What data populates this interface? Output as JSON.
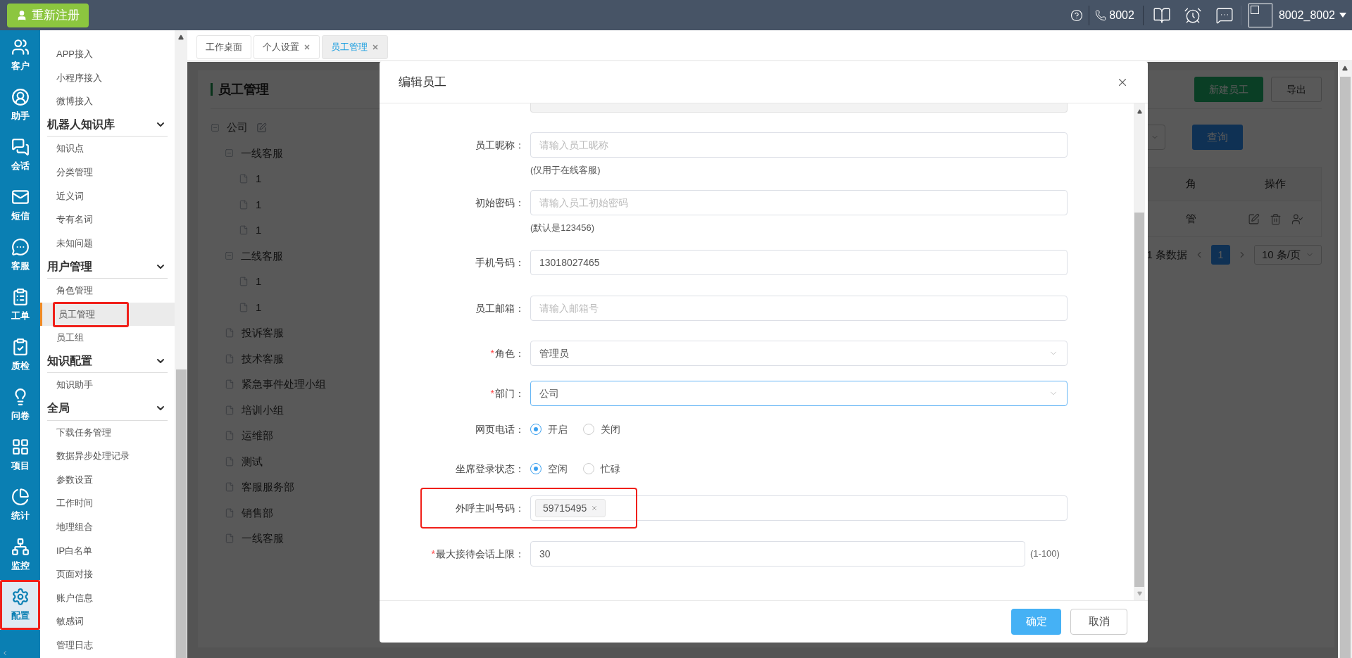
{
  "topbar": {
    "register_button": "重新注册",
    "extension": "8002",
    "user": "8002_8002"
  },
  "rail": [
    {
      "label": "客户",
      "selected": false,
      "highlighted": false
    },
    {
      "label": "助手",
      "selected": false,
      "highlighted": false
    },
    {
      "label": "会话",
      "selected": false,
      "highlighted": false
    },
    {
      "label": "短信",
      "selected": false,
      "highlighted": false
    },
    {
      "label": "客服",
      "selected": false,
      "highlighted": false
    },
    {
      "label": "工单",
      "selected": false,
      "highlighted": false
    },
    {
      "label": "质检",
      "selected": false,
      "highlighted": false
    },
    {
      "label": "问卷",
      "selected": false,
      "highlighted": false
    },
    {
      "label": "项目",
      "selected": false,
      "highlighted": false
    },
    {
      "label": "统计",
      "selected": false,
      "highlighted": false
    },
    {
      "label": "监控",
      "selected": false,
      "highlighted": false
    },
    {
      "label": "配置",
      "selected": true,
      "highlighted": true
    }
  ],
  "submenu": [
    {
      "kind": "item",
      "label": "APP接入",
      "selected": false,
      "highlighted": false
    },
    {
      "kind": "item",
      "label": "小程序接入",
      "selected": false,
      "highlighted": false
    },
    {
      "kind": "item",
      "label": "微博接入",
      "selected": false,
      "highlighted": false
    },
    {
      "kind": "header",
      "label": "机器人知识库",
      "expanded": true
    },
    {
      "kind": "item",
      "label": "知识点",
      "selected": false,
      "highlighted": false
    },
    {
      "kind": "item",
      "label": "分类管理",
      "selected": false,
      "highlighted": false
    },
    {
      "kind": "item",
      "label": "近义词",
      "selected": false,
      "highlighted": false
    },
    {
      "kind": "item",
      "label": "专有名词",
      "selected": false,
      "highlighted": false
    },
    {
      "kind": "item",
      "label": "未知问题",
      "selected": false,
      "highlighted": false
    },
    {
      "kind": "header",
      "label": "用户管理",
      "expanded": true
    },
    {
      "kind": "item",
      "label": "角色管理",
      "selected": false,
      "highlighted": false
    },
    {
      "kind": "item",
      "label": "员工管理",
      "selected": true,
      "highlighted": true
    },
    {
      "kind": "item",
      "label": "员工组",
      "selected": false,
      "highlighted": false
    },
    {
      "kind": "header",
      "label": "知识配置",
      "expanded": true
    },
    {
      "kind": "item",
      "label": "知识助手",
      "selected": false,
      "highlighted": false
    },
    {
      "kind": "header",
      "label": "全局",
      "expanded": true
    },
    {
      "kind": "item",
      "label": "下载任务管理",
      "selected": false,
      "highlighted": false
    },
    {
      "kind": "item",
      "label": "数据异步处理记录",
      "selected": false,
      "highlighted": false
    },
    {
      "kind": "item",
      "label": "参数设置",
      "selected": false,
      "highlighted": false
    },
    {
      "kind": "item",
      "label": "工作时间",
      "selected": false,
      "highlighted": false
    },
    {
      "kind": "item",
      "label": "地理组合",
      "selected": false,
      "highlighted": false
    },
    {
      "kind": "item",
      "label": "IP白名单",
      "selected": false,
      "highlighted": false
    },
    {
      "kind": "item",
      "label": "页面对接",
      "selected": false,
      "highlighted": false
    },
    {
      "kind": "item",
      "label": "账户信息",
      "selected": false,
      "highlighted": false
    },
    {
      "kind": "item",
      "label": "敏感词",
      "selected": false,
      "highlighted": false
    },
    {
      "kind": "item",
      "label": "管理日志",
      "selected": false,
      "highlighted": false
    }
  ],
  "tabs": [
    {
      "label": "工作桌面",
      "selected": false,
      "closable": false
    },
    {
      "label": "个人设置",
      "selected": false,
      "closable": true
    },
    {
      "label": "员工管理",
      "selected": true,
      "closable": true
    }
  ],
  "page": {
    "title": "员工管理",
    "new_button": "新建员工",
    "export_button": "导出",
    "query_button": "查询",
    "tree": [
      {
        "label": "公司",
        "expanded": true,
        "editable": true,
        "children": [
          {
            "label": "一线客服",
            "expanded": true,
            "children": [
              {
                "label": "1"
              },
              {
                "label": "1"
              },
              {
                "label": "1"
              }
            ]
          },
          {
            "label": "二线客服",
            "expanded": true,
            "children": [
              {
                "label": "1"
              },
              {
                "label": "1"
              }
            ]
          },
          {
            "label": "投诉客服"
          },
          {
            "label": "技术客服"
          },
          {
            "label": "紧急事件处理小组"
          },
          {
            "label": "培训小组"
          },
          {
            "label": "运维部"
          },
          {
            "label": "测试"
          },
          {
            "label": "客服服务部"
          },
          {
            "label": "销售部"
          },
          {
            "label": "一线客服"
          }
        ]
      }
    ],
    "table": {
      "columns": [
        "角",
        "操作"
      ],
      "rows": [
        [
          "管"
        ]
      ]
    },
    "pagination": {
      "total": "1 条数据",
      "pages": [
        {
          "label": "1",
          "selected": true
        }
      ],
      "page_size": "10 条/页"
    }
  },
  "dialog": {
    "title": "编辑员工",
    "fields": [
      {
        "kind": "text",
        "label": "员工昵称：",
        "placeholder": "请输入员工昵称",
        "hint": "(仅用于在线客服)"
      },
      {
        "kind": "text",
        "label": "初始密码：",
        "placeholder": "请输入员工初始密码",
        "hint": "(默认是123456)"
      },
      {
        "kind": "text",
        "label": "手机号码：",
        "value": "13018027465"
      },
      {
        "kind": "text",
        "label": "员工邮箱：",
        "placeholder": "请输入邮箱号"
      },
      {
        "kind": "select",
        "label": "角色：",
        "required": "*",
        "value": "管理员",
        "focused": false
      },
      {
        "kind": "select",
        "label": "部门：",
        "required": "*",
        "value": "公司",
        "focused": true
      },
      {
        "kind": "radio",
        "label": "网页电话：",
        "options": [
          {
            "label": "开启",
            "selected": true
          },
          {
            "label": "关闭",
            "selected": false
          }
        ]
      },
      {
        "kind": "radio",
        "label": "坐席登录状态：",
        "options": [
          {
            "label": "空闲",
            "selected": true
          },
          {
            "label": "忙碌",
            "selected": false
          }
        ]
      },
      {
        "kind": "tags",
        "label": "外呼主叫号码：",
        "tags": [
          "59715495"
        ],
        "highlighted": true
      },
      {
        "kind": "text",
        "label": "最大接待会话上限：",
        "required": "*",
        "value": "30",
        "suffix": "(1-100)"
      }
    ],
    "confirm_button": "确定",
    "cancel_button": "取消"
  }
}
